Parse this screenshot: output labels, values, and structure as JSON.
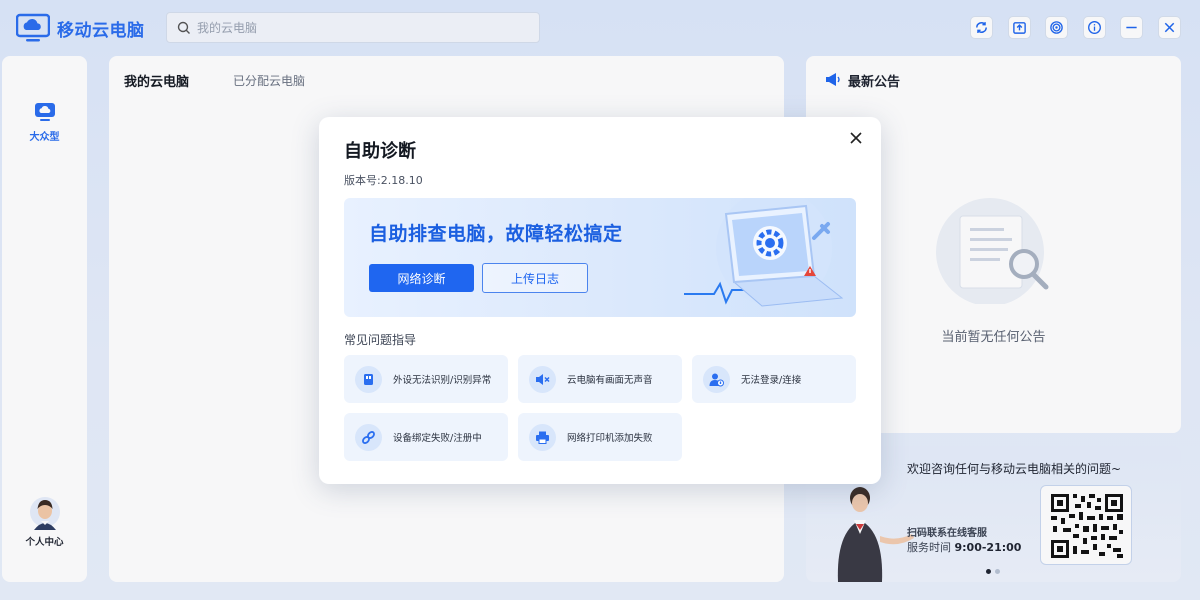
{
  "app": {
    "title": "移动云电脑",
    "search_placeholder": "我的云电脑",
    "accent_color": "#2a6ef0",
    "window_buttons": [
      "refresh-icon",
      "upload-icon",
      "target-icon",
      "info-icon",
      "minimize-icon",
      "close-icon"
    ]
  },
  "sidebar": {
    "items": [
      {
        "label": "大众型",
        "icon": "cloud-monitor-icon",
        "active": true
      },
      {
        "label": "个人中心",
        "icon": "avatar"
      }
    ]
  },
  "main": {
    "tabs": [
      {
        "label": "我的云电脑",
        "active": true
      },
      {
        "label": "已分配云电脑",
        "active": false
      }
    ]
  },
  "notice": {
    "title": "最新公告",
    "empty_text": "当前暂无任何公告"
  },
  "service": {
    "headline": "欢迎咨询任何与移动云电脑相关的问题~",
    "scan_text": "扫码联系在线客服",
    "hours_label": "服务时间",
    "hours_value": "9:00-21:00",
    "carousel_pages": 2,
    "carousel_active": 1
  },
  "modal": {
    "title": "自助诊断",
    "version": "版本号:2.18.10",
    "banner_text": "自助排查电脑，故障轻松搞定",
    "primary_button": "网络诊断",
    "secondary_button": "上传日志",
    "faq_title": "常见问题指导",
    "faq": [
      {
        "label": "外设无法识别/识别异常",
        "icon": "usb-icon"
      },
      {
        "label": "云电脑有画面无声音",
        "icon": "mute-speaker-icon"
      },
      {
        "label": "无法登录/连接",
        "icon": "user-lock-icon"
      },
      {
        "label": "设备绑定失败/注册中",
        "icon": "link-icon"
      },
      {
        "label": "网络打印机添加失败",
        "icon": "printer-icon"
      }
    ]
  }
}
